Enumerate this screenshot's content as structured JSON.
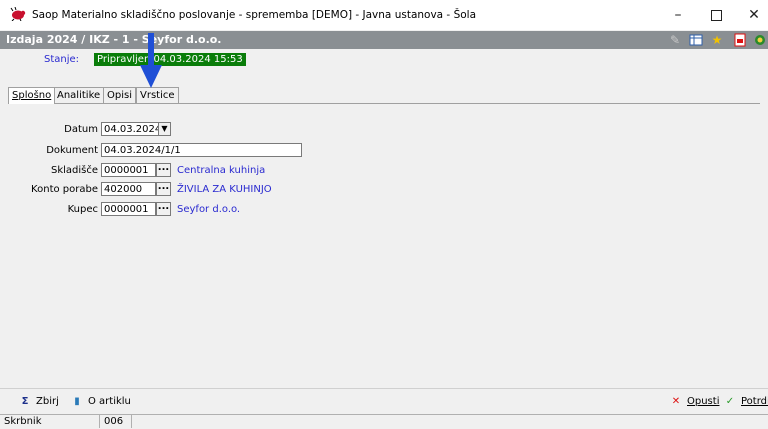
{
  "window": {
    "title": "Saop Materialno skladiščno poslovanje - sprememba [DEMO] - Javna ustanova - Šola",
    "minimize": "–",
    "close": "✕"
  },
  "docbar": {
    "title": "Izdaja 2024 / IKZ - 1 - Seyfor d.o.o.",
    "icons": [
      "edit-icon",
      "grid-icon",
      "star-icon",
      "pdf-icon",
      "refresh-icon"
    ]
  },
  "status": {
    "label": "Stanje:",
    "value": "Pripravljen 04.03.2024 15:53"
  },
  "tabs": [
    {
      "label": "Splošno",
      "active": true
    },
    {
      "label": "Analitike",
      "active": false
    },
    {
      "label": "Opisi",
      "active": false
    },
    {
      "label": "Vrstice",
      "active": false
    }
  ],
  "form": {
    "datum": {
      "label": "Datum",
      "value": "04.03.2024"
    },
    "dokument": {
      "label": "Dokument",
      "value": "04.03.2024/1/1"
    },
    "skladisce": {
      "label": "Skladišče",
      "value": "0000001",
      "desc": "Centralna kuhinja"
    },
    "konto": {
      "label": "Konto porabe",
      "value": "402000",
      "desc": "ŽIVILA ZA KUHINJO"
    },
    "kupec": {
      "label": "Kupec",
      "value": "0000001",
      "desc": "Seyfor d.o.o."
    }
  },
  "buttons": {
    "zbirj": "Zbirj",
    "oartiklu": "O artiklu",
    "opusti": "Opusti",
    "potrdi": "Potrdi"
  },
  "statusbar": {
    "user": "Skrbnik",
    "code": "006"
  },
  "colors": {
    "docbar": "#8a8f93",
    "status_bg": "#0a7d0a",
    "link": "#2a2ad0",
    "arrow": "#1f4fd6"
  }
}
